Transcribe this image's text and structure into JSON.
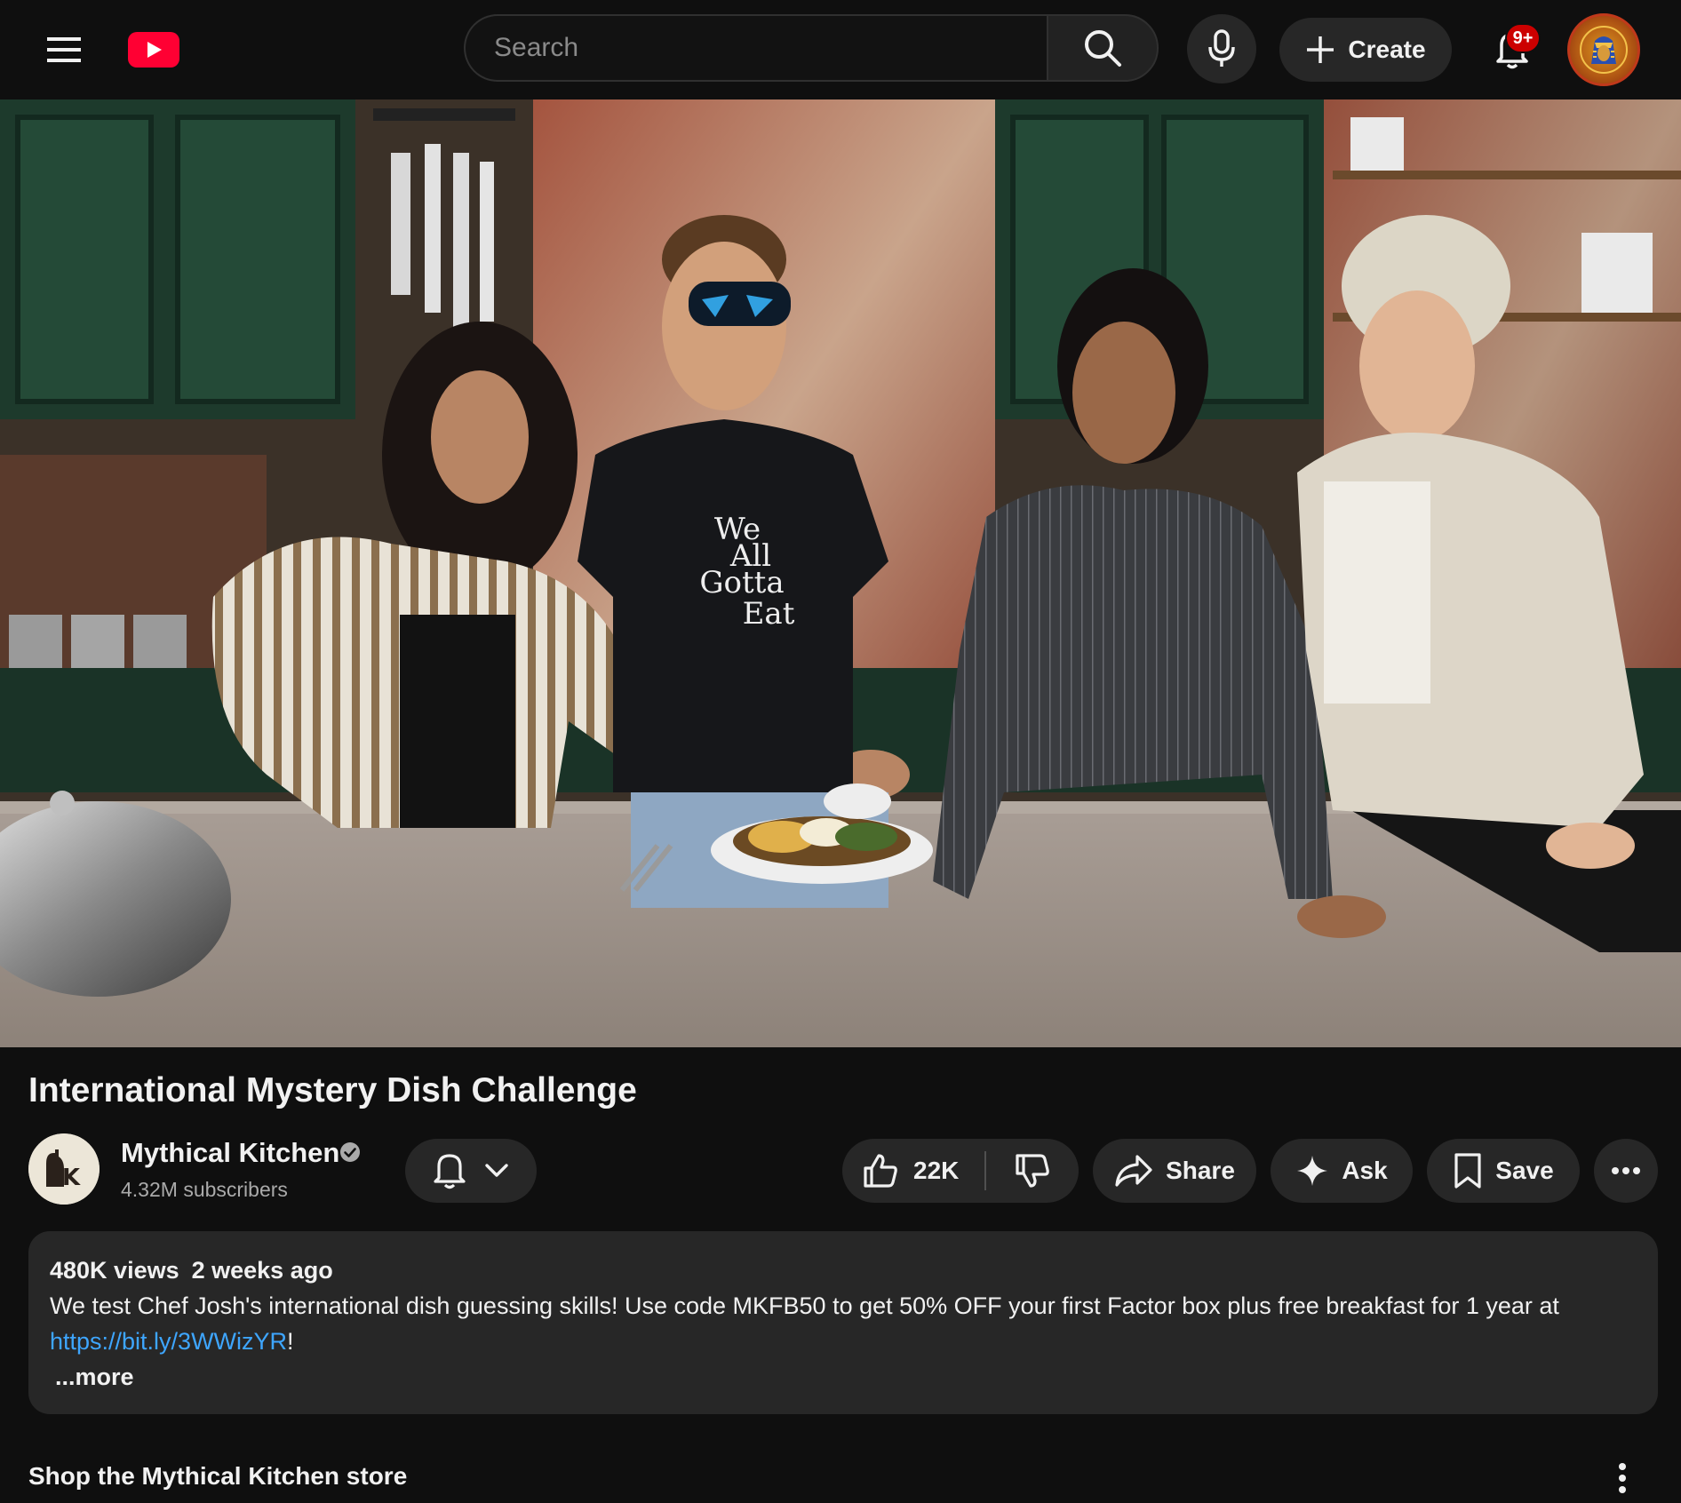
{
  "header": {
    "search_placeholder": "Search",
    "create_label": "Create",
    "notification_count": "9+",
    "icons": {
      "menu": "hamburger-menu-icon",
      "logo": "youtube-logo-icon",
      "search": "search-icon",
      "mic": "microphone-icon",
      "create": "plus-icon",
      "notifications": "bell-icon"
    }
  },
  "video": {
    "title": "International Mystery Dish Challenge",
    "shirt_text": [
      "We",
      "All",
      "Gotta",
      "Eat"
    ]
  },
  "channel": {
    "name": "Mythical Kitchen",
    "subscribers": "4.32M subscribers",
    "avatar_letters": "MK",
    "verified": true
  },
  "actions": {
    "likes": "22K",
    "share_label": "Share",
    "ask_label": "Ask",
    "save_label": "Save"
  },
  "description": {
    "views": "480K views",
    "posted": "2 weeks ago",
    "text": "We test Chef Josh's international dish guessing skills! Use code MKFB50 to get 50% OFF your first Factor box plus free breakfast for 1 year at",
    "link": "https://bit.ly/3WWizYR",
    "link_suffix": "!",
    "more_label": "...more"
  },
  "shop": {
    "title": "Shop the Mythical Kitchen store"
  },
  "colors": {
    "background": "#0f0f0f",
    "button_bg": "#272727",
    "brand_red": "#ff0033",
    "badge_red": "#cc0000",
    "link_blue": "#3ea6ff",
    "secondary_text": "#aaaaaa"
  }
}
